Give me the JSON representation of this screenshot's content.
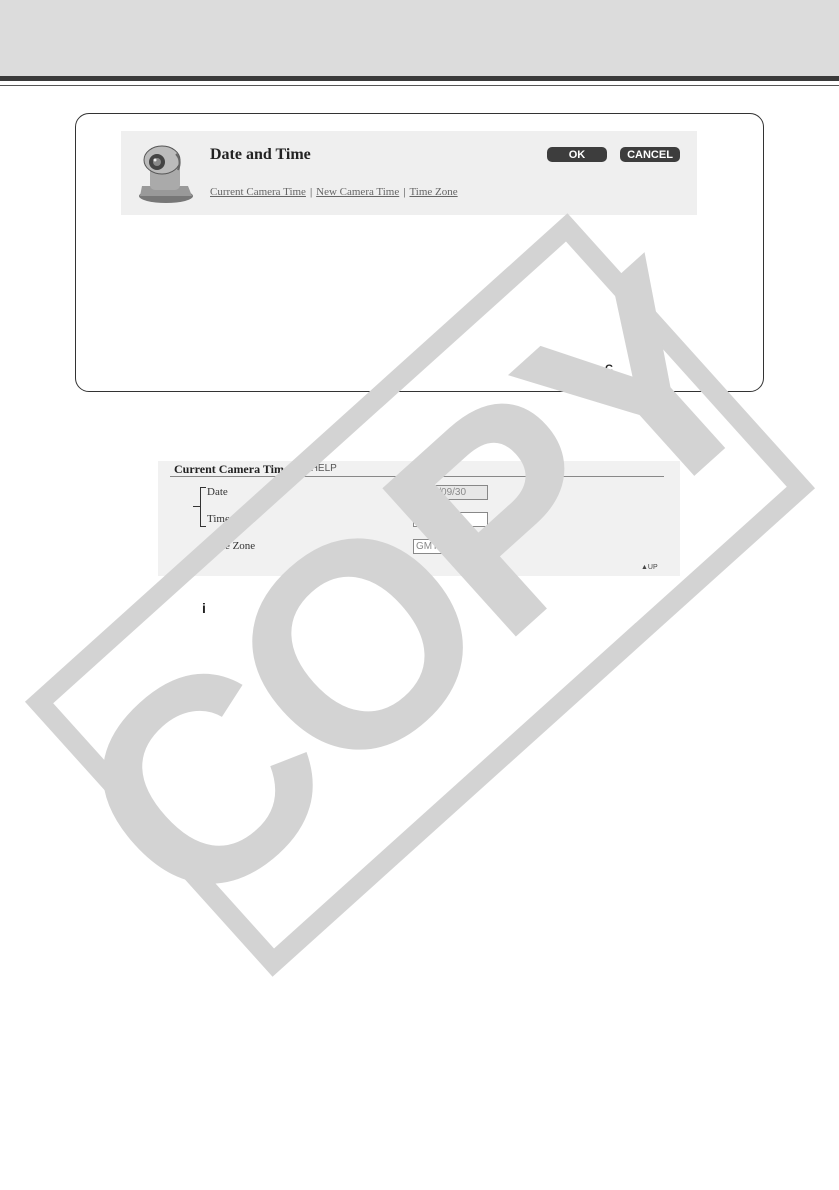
{
  "header": {
    "title": "Date and Time",
    "ok_label": "OK",
    "cancel_label": "CANCEL",
    "links": [
      "Current Camera Time",
      "New Camera Time",
      "Time Zone"
    ],
    "separator": "|"
  },
  "callout_marker": "C",
  "current_camera_time": {
    "title": "Current Camera Time",
    "help_label": "▶HELP",
    "rows": [
      {
        "label": "Date",
        "value": "2004/09/30"
      },
      {
        "label": "Time",
        "value": "21:47:07"
      },
      {
        "label": "Time Zone",
        "value": "GMT+09"
      }
    ],
    "up_label": "▲UP"
  },
  "info_marker": "i",
  "watermark": "COPY",
  "colors": {
    "accent_button": "#3d3d3d",
    "panel_bg": "#efefef",
    "watermark": "#d3d3d3"
  }
}
